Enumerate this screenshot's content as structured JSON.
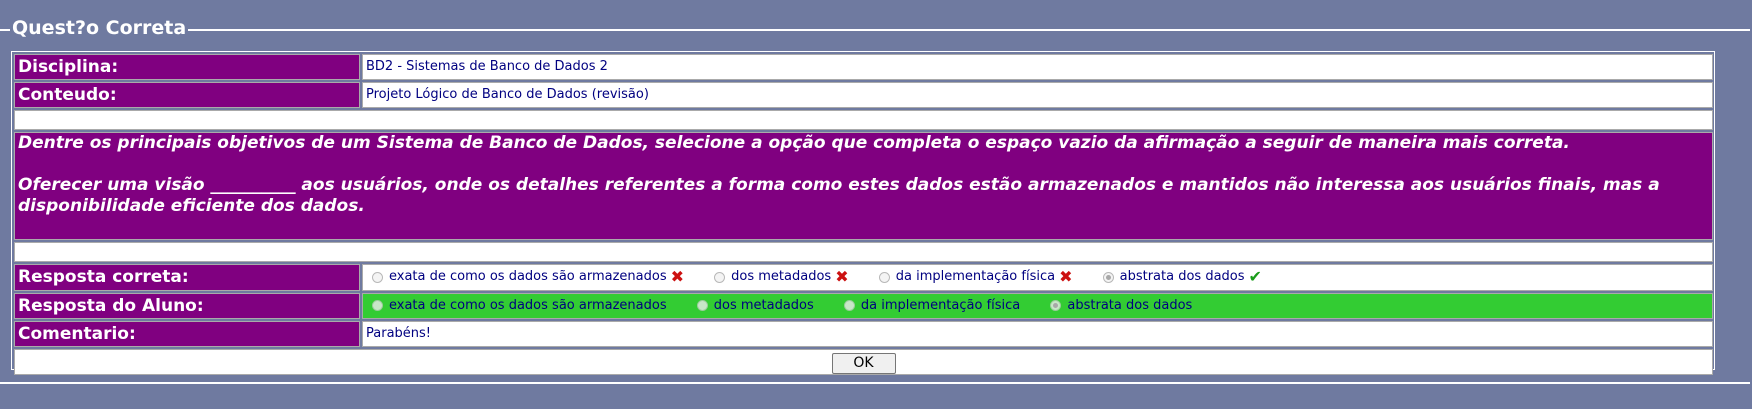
{
  "title": "Quest?o Correta",
  "rows": {
    "disciplina": {
      "label": "Disciplina:",
      "value": "BD2 - Sistemas de Banco de Dados 2"
    },
    "conteudo": {
      "label": "Conteudo:",
      "value": "Projeto Lógico de Banco de Dados (revisão)"
    }
  },
  "question": {
    "line1": "Dentre os principais objetivos de um Sistema de Banco de Dados, selecione a opção que completa o espaço vazio da afirmação a seguir de maneira mais correta.",
    "line2": "Oferecer uma visão __________ aos usuários, onde os detalhes referentes a forma como estes dados estão armazenados e mantidos não interessa aos usuários finais, mas a disponibilidade eficiente dos dados."
  },
  "correct": {
    "label": "Resposta correta:",
    "options": [
      {
        "text": "exata de como os dados são armazenados",
        "mark": "wrong-icon"
      },
      {
        "text": "dos metadados",
        "mark": "wrong-icon"
      },
      {
        "text": "da implementação física",
        "mark": "wrong-icon"
      },
      {
        "text": "abstrata dos dados",
        "mark": "correct-icon",
        "selected": true
      }
    ]
  },
  "student": {
    "label": "Resposta do Aluno:",
    "options": [
      {
        "text": "exata de como os dados são armazenados"
      },
      {
        "text": "dos metadados"
      },
      {
        "text": "da implementação física"
      },
      {
        "text": "abstrata dos dados",
        "selected": true
      }
    ]
  },
  "comment": {
    "label": "Comentario:",
    "value": "Parabéns!"
  },
  "ok_label": "OK",
  "colors": {
    "background": "#6f7aa0",
    "label_bg": "#800080",
    "student_bg": "#33cc33",
    "value_text": "#000080"
  }
}
